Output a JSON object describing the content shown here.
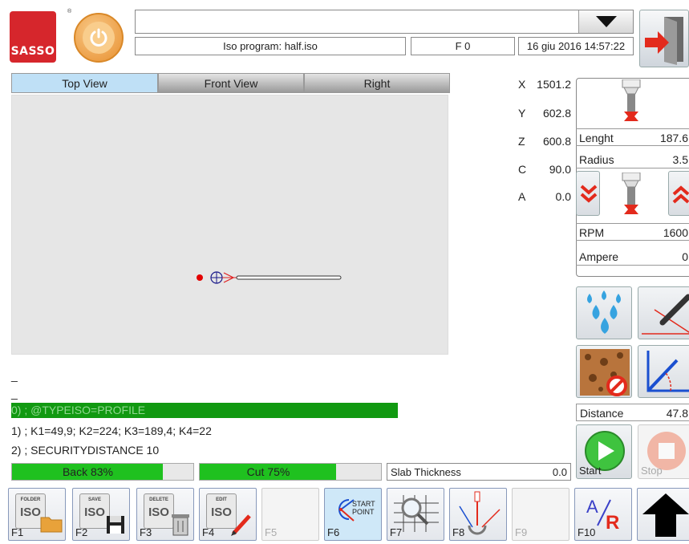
{
  "header": {
    "logo_text": "SASSO",
    "reg_mark": "®",
    "program_label": "Iso program: half.iso",
    "feed_label": "F 0",
    "datetime": "16 giu 2016 14:57:22",
    "top_input_value": ""
  },
  "view_tabs": [
    {
      "label": "Top View",
      "active": true
    },
    {
      "label": "Front View",
      "active": false
    },
    {
      "label": "Right",
      "active": false
    }
  ],
  "coordinates": [
    {
      "axis": "X",
      "value": "1501.2"
    },
    {
      "axis": "Y",
      "value": "602.8"
    },
    {
      "axis": "Z",
      "value": "600.8"
    },
    {
      "axis": "C",
      "value": "90.0"
    },
    {
      "axis": "A",
      "value": "0.0"
    }
  ],
  "tool": {
    "length_label": "Lenght",
    "length_value": "187.6",
    "radius_label": "Radius",
    "radius_value": "3.5",
    "rpm_label": "RPM",
    "rpm_value": "1600",
    "ampere_label": "Ampere",
    "ampere_value": "0"
  },
  "distance": {
    "label": "Distance",
    "value": "47.8"
  },
  "code": {
    "marker1": "_",
    "marker2": "_",
    "lines": [
      "0) ; @TYPEISO=PROFILE",
      "1) ; K1=49,9; K2=224; K3=189,4; K4=22",
      "2) ; SECURITYDISTANCE 10"
    ],
    "highlight_color": "#119911"
  },
  "progress": {
    "back": {
      "label": "Back 83%",
      "fraction": 0.83
    },
    "cut": {
      "label": "Cut 75%",
      "fraction": 0.75
    },
    "slab_label": "Slab Thickness",
    "slab_value": "0.0"
  },
  "start_stop": {
    "start": "Start",
    "stop": "Stop"
  },
  "fkeys": [
    {
      "key": "F1",
      "icon": "folder-iso-icon",
      "icon_text": "FOLDER"
    },
    {
      "key": "F2",
      "icon": "save-iso-icon",
      "icon_text": "SAVE"
    },
    {
      "key": "F3",
      "icon": "delete-iso-icon",
      "icon_text": "DELETE"
    },
    {
      "key": "F4",
      "icon": "edit-iso-icon",
      "icon_text": "EDIT"
    },
    {
      "key": "F5",
      "icon": "",
      "icon_text": ""
    },
    {
      "key": "F6",
      "icon": "start-point-icon",
      "icon_text": "START POINT"
    },
    {
      "key": "F7",
      "icon": "zoom-grid-icon",
      "icon_text": ""
    },
    {
      "key": "F8",
      "icon": "probe-icon",
      "icon_text": ""
    },
    {
      "key": "F9",
      "icon": "",
      "icon_text": ""
    },
    {
      "key": "F10",
      "icon": "ar-icon",
      "icon_text": "A/R"
    }
  ],
  "iso_word": "ISO",
  "colors": {
    "accent_tab": "#bfe0f6",
    "progress_green": "#1fc11f",
    "brand_red": "#d6262c"
  }
}
